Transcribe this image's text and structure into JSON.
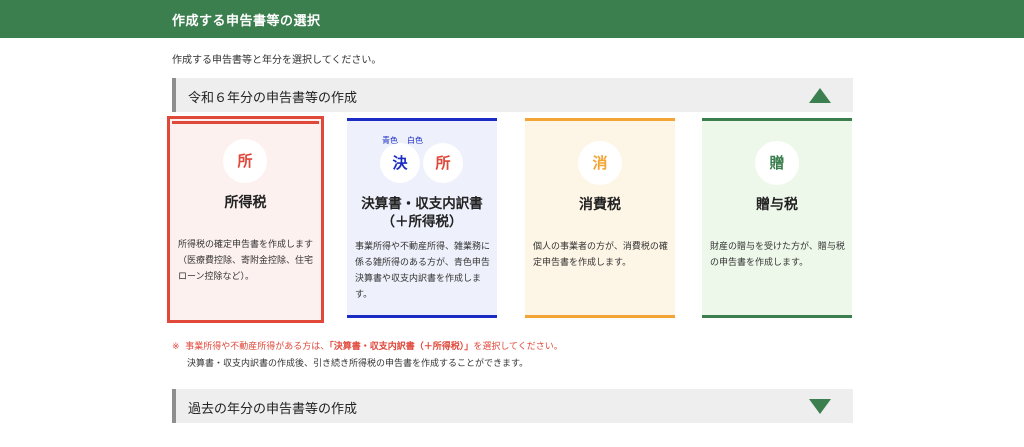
{
  "header": {
    "title": "作成する申告書等の選択"
  },
  "intro": "作成する申告書等と年分を選択してください。",
  "section_current": {
    "title": "令和６年分の申告書等の作成"
  },
  "cards": {
    "income": {
      "circle": "所",
      "title": "所得税",
      "desc": "所得税の確定申告書を作成します（医療費控除、寄附金控除、住宅ローン控除など）。"
    },
    "blue": {
      "small_a": "青色",
      "small_b": "白色",
      "circle_a": "決",
      "circle_b": "所",
      "title_line1": "決算書・収支内訳書",
      "title_line2": "（＋所得税）",
      "desc": "事業所得や不動産所得、雑業務に係る雑所得のある方が、青色申告決算書や収支内訳書を作成します。"
    },
    "consumption": {
      "circle": "消",
      "title": "消費税",
      "desc": "個人の事業者の方が、消費税の確定申告書を作成します。"
    },
    "gift": {
      "circle": "贈",
      "title": "贈与税",
      "desc": "財産の贈与を受けた方が、贈与税の申告書を作成します。"
    }
  },
  "note": {
    "mark": "※",
    "part1": "事業所得や不動産所得がある方は、",
    "strong": "「決算書・収支内訳書（＋所得税）」",
    "part2": "を選択してください。",
    "line2": "決算書・収支内訳書の作成後、引き続き所得税の申告書を作成することができます。"
  },
  "section_past": {
    "title": "過去の年分の申告書等の作成"
  },
  "colors": {
    "header_green": "#3c7f4e",
    "income_red": "#e0483a",
    "blue": "#1b2cc4",
    "orange": "#f2a534"
  }
}
